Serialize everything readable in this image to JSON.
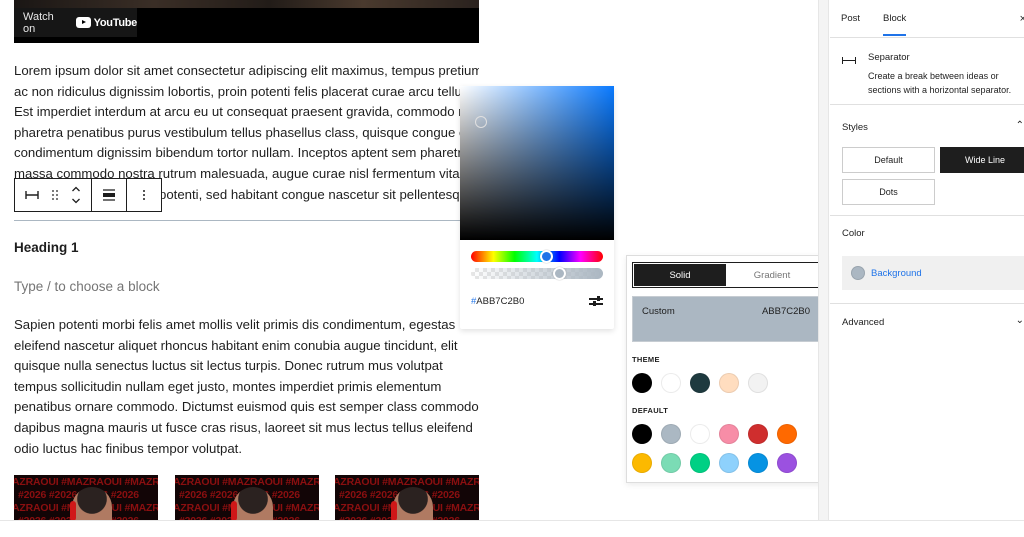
{
  "video": {
    "watch_on": "Watch on",
    "platform": "YouTube"
  },
  "editor": {
    "paragraph1_lines": [
      "Lorem ipsum dolor sit amet consectetur adipiscing elit maximus, tempus pretium",
      "ac non ridiculus dignissim lobortis, proin potenti felis placerat curae arcu tellus",
      "Est imperdiet interdum at arcu eu ut consequat praesent gravida, commodo risus",
      "pharetra penatibus purus vestibulum tellus phasellus class, quisque congue odio",
      "condimentum dignissim bibendum tortor nullam. Inceptos aptent sem pharetra",
      "massa commodo nostra rutrum malesuada, augue curae nisl fermentum vitae",
      "potenti, sed habitant congue nascetur sit pellentesque et"
    ],
    "heading": "Heading 1",
    "placeholder": "Type / to choose a block",
    "paragraph2_lines": [
      "Sapien potenti morbi felis amet mollis velit primis dis condimentum, egestas",
      "eleifend nascetur aliquet rhoncus habitant enim conubia augue tincidunt, elit",
      "quisque nulla senectus luctus sit lectus turpis. Donec rutrum mus volutpat",
      "tempus sollicitudin nullam eget justo, montes imperdiet primis elementum",
      "penatibus ornare commodo. Dictumst euismod quis est semper class commodo",
      "dapibus magna mauris ut fusce cras risus, laoreet sit mus lectus tellus eleifend",
      "odio luctus hac finibus tempor volutpat."
    ],
    "gallery_text_line1": "AZRAOUI #MAZRAOUI #MAZRA",
    "gallery_text_line2": "#2026 #2026 #2026 #2026",
    "separator_color": "#ABB7C2"
  },
  "block_toolbar": {
    "icons": [
      "separator-icon",
      "drag-handle-icon",
      "move-up-down-icon",
      "align-wide-icon",
      "more-options-icon"
    ]
  },
  "color_picker": {
    "hex_value": "ABB7C2B0",
    "hex_prefix": "#",
    "hue_fraction": 0.58,
    "alpha_fraction": 0.69,
    "selected_color": "#ABB7C2"
  },
  "palette": {
    "tabs": [
      {
        "label": "Solid",
        "active": true
      },
      {
        "label": "Gradient",
        "active": false
      }
    ],
    "custom_label": "Custom",
    "custom_value": "ABB7C2B0",
    "theme_label": "THEME",
    "theme_colors": [
      "#000000",
      "#FFFFFF",
      "#1E3A3F",
      "#FFDDBF",
      "#F2F2F2"
    ],
    "default_label": "DEFAULT",
    "default_colors_row1": [
      "#000000",
      "#ABB8C3",
      "#FFFFFF",
      "#F78DA7",
      "#CF2E2E",
      "#FF6900"
    ],
    "default_colors_row2": [
      "#FCB900",
      "#7BDCB5",
      "#00D084",
      "#8ED1FC",
      "#0693E3",
      "#9B51E0"
    ]
  },
  "sidebar": {
    "tabs": [
      {
        "label": "Post",
        "active": false
      },
      {
        "label": "Block",
        "active": true
      }
    ],
    "close": "×",
    "block": {
      "title": "Separator",
      "description_lines": [
        "Create a break between ideas or",
        "sections with a horizontal separator."
      ]
    },
    "styles": {
      "title": "Styles",
      "options": [
        {
          "label": "Default",
          "active": false
        },
        {
          "label": "Wide Line",
          "active": true
        },
        {
          "label": "Dots",
          "active": false
        }
      ]
    },
    "color": {
      "title": "Color",
      "background_label": "Background",
      "background_color": "#ABB7C2"
    },
    "advanced": {
      "title": "Advanced"
    }
  }
}
